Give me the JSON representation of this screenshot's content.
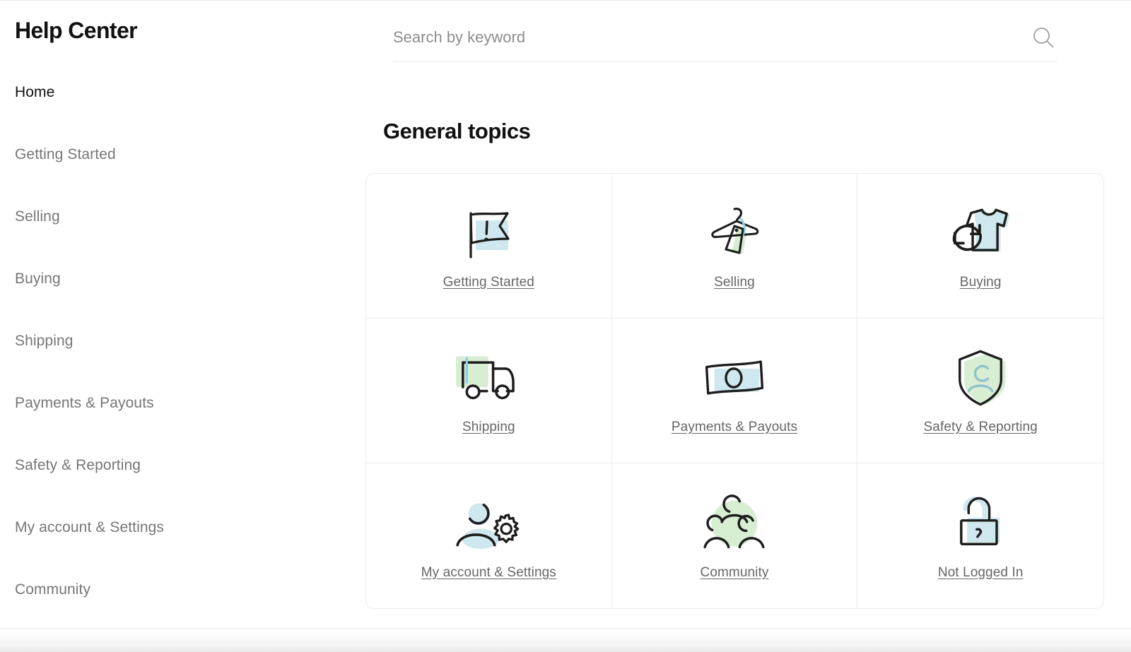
{
  "sidebar": {
    "brand_title": "Help Center",
    "items": [
      {
        "label": "Home",
        "active": true
      },
      {
        "label": "Getting Started",
        "active": false
      },
      {
        "label": "Selling",
        "active": false
      },
      {
        "label": "Buying",
        "active": false
      },
      {
        "label": "Shipping",
        "active": false
      },
      {
        "label": "Payments & Payouts",
        "active": false
      },
      {
        "label": "Safety & Reporting",
        "active": false
      },
      {
        "label": "My account & Settings",
        "active": false
      },
      {
        "label": "Community",
        "active": false
      }
    ]
  },
  "search": {
    "placeholder": "Search by keyword",
    "value": "",
    "icon": "search-icon"
  },
  "main": {
    "section_title": "General topics",
    "topics": [
      {
        "label": "Getting Started",
        "icon": "flag-exclamation-icon",
        "accent": "#cfe7ee"
      },
      {
        "label": "Selling",
        "icon": "hanger-price-tag-icon",
        "accent": "#d7eed2"
      },
      {
        "label": "Buying",
        "icon": "tshirt-refresh-icon",
        "accent": "#cfe7ee"
      },
      {
        "label": "Shipping",
        "icon": "delivery-truck-icon",
        "accent": "#d7eed2"
      },
      {
        "label": "Payments & Payouts",
        "icon": "banknote-icon",
        "accent": "#cfe7ee"
      },
      {
        "label": "Safety & Reporting",
        "icon": "shield-person-icon",
        "accent": "#d7eed2"
      },
      {
        "label": "My account & Settings",
        "icon": "person-gear-icon",
        "accent": "#cfe7ee"
      },
      {
        "label": "Community",
        "icon": "three-people-icon",
        "accent": "#d7eed2"
      },
      {
        "label": "Not Logged In",
        "icon": "padlock-icon",
        "accent": "#cfe7ee"
      }
    ]
  },
  "colors": {
    "text_primary": "#111111",
    "text_muted": "#767676",
    "link": "#666666",
    "border": "#ebebeb",
    "accent_blue": "#cfe7ee",
    "accent_green": "#d7eed2",
    "background": "#ffffff"
  }
}
